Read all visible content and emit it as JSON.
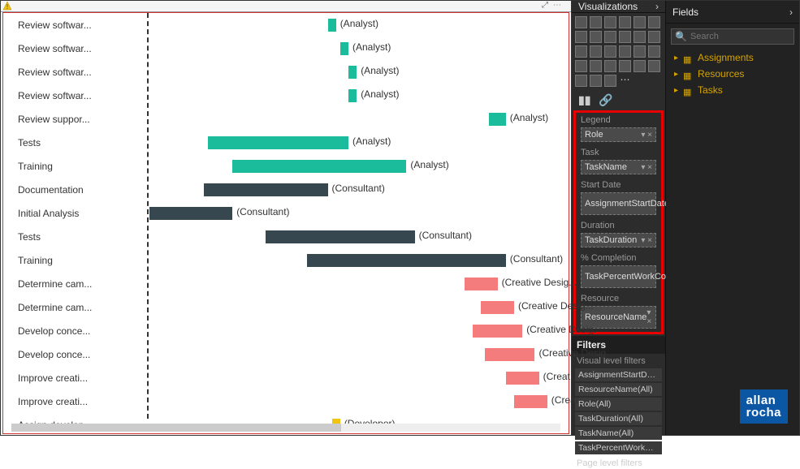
{
  "panels": {
    "visualizations": "Visualizations",
    "fields": "Fields",
    "search_placeholder": "Search"
  },
  "chart_data": {
    "type": "bar",
    "orientation": "horizontal",
    "title": "",
    "today_x": 8,
    "x_range": [
      0,
      100
    ],
    "categories": [
      "Review softwar...",
      "Review softwar...",
      "Review softwar...",
      "Review softwar...",
      "Review suppor...",
      "Tests",
      "Training",
      "Documentation",
      "Initial Analysis",
      "Tests",
      "Training",
      "Determine cam...",
      "Determine cam...",
      "Develop conce...",
      "Develop conce...",
      "Improve creati...",
      "Improve creati...",
      "Assign develop..."
    ],
    "series_labels": [
      "(Analyst)",
      "(Analyst)",
      "(Analyst)",
      "(Analyst)",
      "(Analyst)",
      "(Analyst)",
      "(Analyst)",
      "(Consultant)",
      "(Consultant)",
      "(Consultant)",
      "(Consultant)",
      "(Creative Desig...",
      "(Creative Desig...",
      "(Creative Desig.",
      "(Creative Desig",
      "(Creat",
      "(Creat",
      "(Developer)"
    ],
    "bars": [
      {
        "start": 45,
        "width": 2,
        "color": "#1abc9c"
      },
      {
        "start": 48,
        "width": 2,
        "color": "#1abc9c"
      },
      {
        "start": 50,
        "width": 2,
        "color": "#1abc9c"
      },
      {
        "start": 50,
        "width": 2,
        "color": "#1abc9c"
      },
      {
        "start": 84,
        "width": 4,
        "color": "#1abc9c"
      },
      {
        "start": 16,
        "width": 34,
        "color": "#1abc9c"
      },
      {
        "start": 22,
        "width": 42,
        "color": "#1abc9c"
      },
      {
        "start": 15,
        "width": 30,
        "color": "#37474f"
      },
      {
        "start": 2,
        "width": 20,
        "color": "#37474f"
      },
      {
        "start": 30,
        "width": 36,
        "color": "#37474f"
      },
      {
        "start": 40,
        "width": 48,
        "color": "#37474f"
      },
      {
        "start": 78,
        "width": 8,
        "color": "#f47c7c"
      },
      {
        "start": 82,
        "width": 8,
        "color": "#f47c7c"
      },
      {
        "start": 80,
        "width": 12,
        "color": "#f47c7c"
      },
      {
        "start": 83,
        "width": 12,
        "color": "#f47c7c"
      },
      {
        "start": 88,
        "width": 8,
        "color": "#f47c7c"
      },
      {
        "start": 90,
        "width": 8,
        "color": "#f47c7c"
      },
      {
        "start": 46,
        "width": 2,
        "color": "#f1c40f"
      }
    ]
  },
  "field_wells": [
    {
      "label": "Legend",
      "value": "Role"
    },
    {
      "label": "Task",
      "value": "TaskName"
    },
    {
      "label": "Start Date",
      "value": "AssignmentStartDate"
    },
    {
      "label": "Duration",
      "value": "TaskDuration"
    },
    {
      "label": "% Completion",
      "value": "TaskPercentWorkCom..."
    },
    {
      "label": "Resource",
      "value": "ResourceName"
    }
  ],
  "filters_header": "Filters",
  "filters_sub": "Visual level filters",
  "filters": [
    "AssignmentStartDate(All)",
    "ResourceName(All)",
    "Role(All)",
    "TaskDuration(All)",
    "TaskName(All)",
    "TaskPercentWorkComplet..."
  ],
  "filters_footer": "Page level filters",
  "field_tables": [
    "Assignments",
    "Resources",
    "Tasks"
  ],
  "brand": {
    "l1": "allan",
    "l2": "rocha"
  }
}
